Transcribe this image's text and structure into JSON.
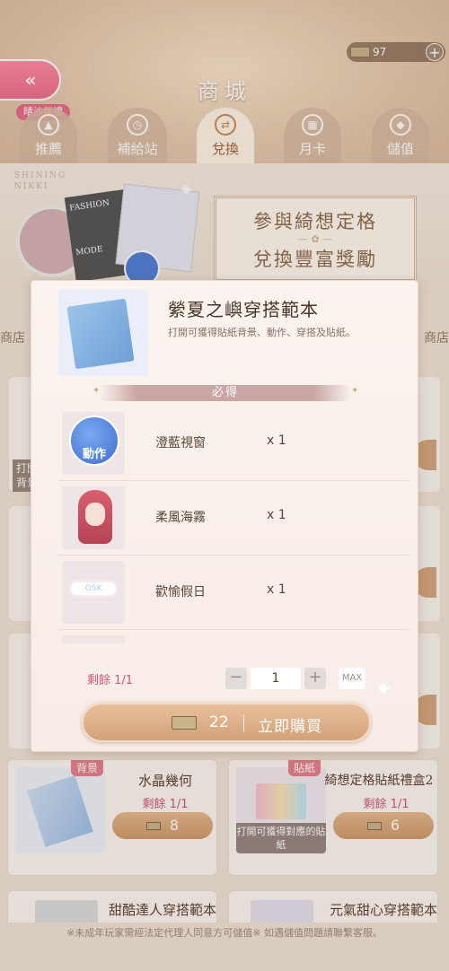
{
  "header": {
    "currency_amount": "97",
    "back_icon": "double-chevron-left-icon",
    "title": "商城",
    "tag": "晴沙伴禮"
  },
  "tabs": [
    {
      "label": "推薦",
      "icon": "thumbs-up-icon"
    },
    {
      "label": "補給站",
      "icon": "clock-icon"
    },
    {
      "label": "兌換",
      "icon": "exchange-icon",
      "active": true
    },
    {
      "label": "月卡",
      "icon": "calendar-icon"
    },
    {
      "label": "儲值",
      "icon": "diamond-icon"
    }
  ],
  "banner": {
    "brand_line1": "SHINING",
    "brand_line2": "NIKKI",
    "card_text1": "FASHION",
    "card_text2": "MODE",
    "headline1": "參與綺想定格",
    "headline2": "兌換豐富獎勵"
  },
  "background": {
    "left_tab_text": "商店",
    "right_tab_text": "商店",
    "left_snippet_line1": "打開",
    "left_snippet_line2": "背景"
  },
  "modal": {
    "title": "縈夏之嶼穿搭範本",
    "description": "打開可獲得貼紙背景、動作、穿搭及貼紙。",
    "section_label": "必得",
    "items": [
      {
        "name": "澄藍視窗",
        "qty": "x 1",
        "thumb_label": "動作"
      },
      {
        "name": "柔風海霧",
        "qty": "x 1"
      },
      {
        "name": "歡愉假日",
        "qty": "x 1",
        "thumb_label": "OSK"
      }
    ],
    "remaining": "剩餘 1/1",
    "quantity": "1",
    "minus": "−",
    "plus": "+",
    "max_label": "MAX",
    "price": "22",
    "buy_label": "立即購買"
  },
  "cards": [
    {
      "badge": "背景",
      "title": "水晶幾何",
      "remaining": "剩餘 1/1",
      "price": "8"
    },
    {
      "badge": "貼紙",
      "title": "綺想定格貼紙禮盒2",
      "remaining": "剩餘 1/1",
      "price": "6",
      "info": "打開可獲得對應的貼紙"
    }
  ],
  "cards_partial": [
    {
      "title": "甜酷達人穿搭範本"
    },
    {
      "title": "元氣甜心穿搭範本"
    }
  ],
  "footer": "※未成年玩家需經法定代理人同意方可儲值※ 如遇儲值問題請聯繫客服。",
  "colors": {
    "accent_pink": "#e86a86",
    "button_gold": "#d2a27a",
    "remaining_red": "#d2567b"
  }
}
